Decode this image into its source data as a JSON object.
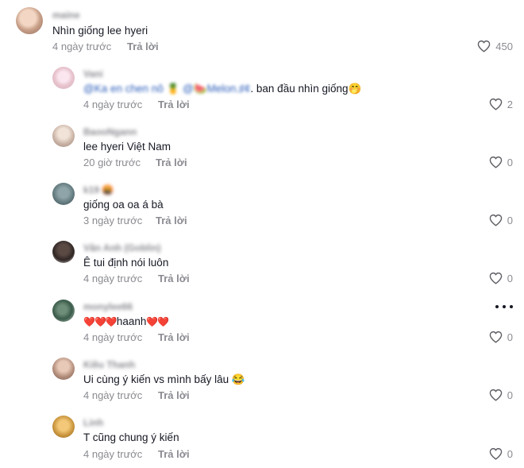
{
  "comments": [
    {
      "username": "maine",
      "text": "Nhìn giống lee hyeri",
      "time": "4 ngày trước",
      "reply": "Trả lời",
      "likes": "450"
    },
    {
      "username": "Vani",
      "mention1": "@Ka en chen nô 🍍",
      "mention2": "@🍉Melon.♯¢",
      "text": ". ban đầu nhìn giống🤭",
      "time": "4 ngày trước",
      "reply": "Trả lời",
      "likes": "2"
    },
    {
      "username": "BaooNgann",
      "text": "lee hyeri Việt Nam",
      "time": "20 giờ trước",
      "reply": "Trả lời",
      "likes": "0"
    },
    {
      "username": "k19 🤬",
      "text": "giống oa oa á bà",
      "time": "3 ngày trước",
      "reply": "Trả lời",
      "likes": "0"
    },
    {
      "username": "Vân Anh (Goblin)",
      "text": "Ê tui định nói luôn",
      "time": "4 ngày trước",
      "reply": "Trả lời",
      "likes": "0"
    },
    {
      "username": "monylee66",
      "text_prefix": "❤️❤️❤️",
      "text": "haanh",
      "text_suffix": "❤️❤️",
      "time": "4 ngày trước",
      "reply": "Trả lời",
      "likes": "0"
    },
    {
      "username": "Kiều Thanh",
      "text": "Ui cùng ý kiến vs mình bấy lâu 😂",
      "time": "4 ngày trước",
      "reply": "Trả lời",
      "likes": "0"
    },
    {
      "username": "Linh",
      "text": "T cũng chung ý kiến",
      "time": "4 ngày trước",
      "reply": "Trả lời",
      "likes": "0"
    }
  ]
}
